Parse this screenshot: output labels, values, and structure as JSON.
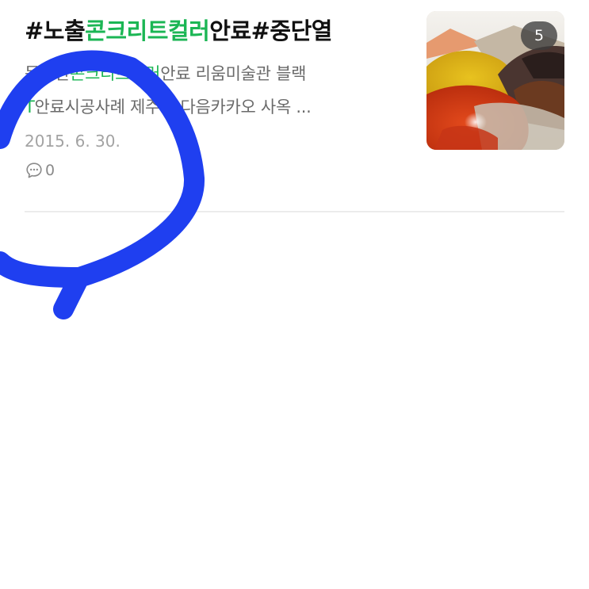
{
  "post": {
    "title_parts": {
      "prefix": "#노출",
      "highlight": "콘크리트컬러",
      "suffix": "안료#중단열"
    },
    "snippet_parts": {
      "part1": "독일산",
      "highlight": "콘크리트컬러",
      "part2": "안료 리움미술관 블랙",
      "line2_prefix": "T",
      "line2_rest": "안료시공사례 제주도 다음카카오 사옥 ..."
    },
    "date": "2015. 6. 30.",
    "comment_icon": "speech-bubble-icon",
    "comment_count": "0",
    "thumbnail": {
      "badge_count": "5",
      "description": ""
    }
  },
  "colors": {
    "highlight": "#1bb654",
    "annotation_stroke": "#1f3ff0",
    "title": "#111111",
    "snippet": "#6a6a6a",
    "date": "#a3a3a3"
  }
}
